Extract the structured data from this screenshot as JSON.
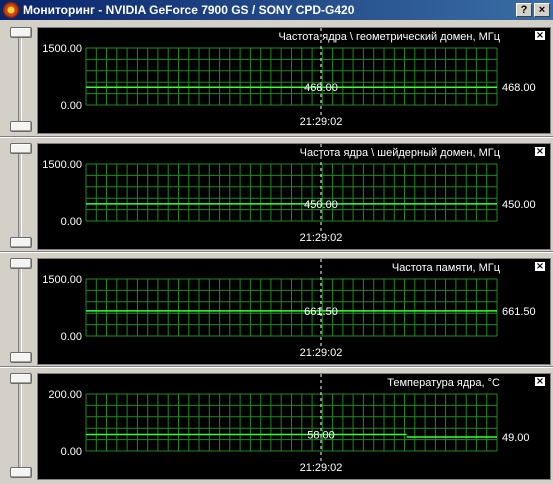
{
  "window": {
    "title": "Мониторинг - NVIDIA GeForce 7900 GS / SONY CPD-G420",
    "help_label": "?",
    "close_label": "×"
  },
  "graphs": [
    {
      "title": "Частота ядра \\ геометрический домен, МГц",
      "y_max_label": "1500.00",
      "y_min_label": "0.00",
      "y_max": 1500,
      "y_min": 0,
      "cursor_value": "468.00",
      "current_value": "468.00",
      "timestamp": "21:29:02",
      "series": [
        {
          "from": 0,
          "to": 1,
          "value": 468
        }
      ],
      "close_label": "×"
    },
    {
      "title": "Частота ядра \\ шейдерный домен, МГц",
      "y_max_label": "1500.00",
      "y_min_label": "0.00",
      "y_max": 1500,
      "y_min": 0,
      "cursor_value": "450.00",
      "current_value": "450.00",
      "timestamp": "21:29:02",
      "series": [
        {
          "from": 0,
          "to": 1,
          "value": 450
        }
      ],
      "close_label": "×"
    },
    {
      "title": "Частота памяти, МГц",
      "y_max_label": "1500.00",
      "y_min_label": "0.00",
      "y_max": 1500,
      "y_min": 0,
      "cursor_value": "661.50",
      "current_value": "661.50",
      "timestamp": "21:29:02",
      "series": [
        {
          "from": 0,
          "to": 1,
          "value": 661.5
        }
      ],
      "close_label": "×"
    },
    {
      "title": "Температура ядра, °С",
      "y_max_label": "200.00",
      "y_min_label": "0.00",
      "y_max": 200,
      "y_min": 0,
      "cursor_value": "58.00",
      "current_value": "49.00",
      "timestamp": "21:29:02",
      "series": [
        {
          "from": 0,
          "to": 0.78,
          "value": 58
        },
        {
          "from": 0.78,
          "to": 1,
          "value": 49
        }
      ],
      "close_label": "×"
    }
  ],
  "colors": {
    "plot_bg": "#000000",
    "grid": "#1f8a1f",
    "line": "#3cff3c",
    "cursor": "#ffffff",
    "text": "#ffffff"
  }
}
